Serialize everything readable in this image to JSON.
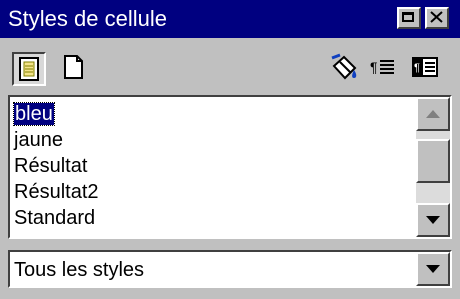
{
  "window": {
    "title": "Styles de cellule"
  },
  "toolbar": {
    "left_icons": [
      "cell-styles-icon",
      "page-styles-icon"
    ],
    "right_icons": [
      "fill-format-icon",
      "new-style-icon",
      "update-style-icon"
    ]
  },
  "styles_list": {
    "items": [
      "bleu",
      "jaune",
      "Résultat",
      "Résultat2",
      "Standard"
    ],
    "selected": "bleu"
  },
  "filter": {
    "value": "Tous les styles"
  },
  "colors": {
    "titlebar": "#000080",
    "window_bg": "#c0c0c0",
    "selection": "#000080"
  }
}
